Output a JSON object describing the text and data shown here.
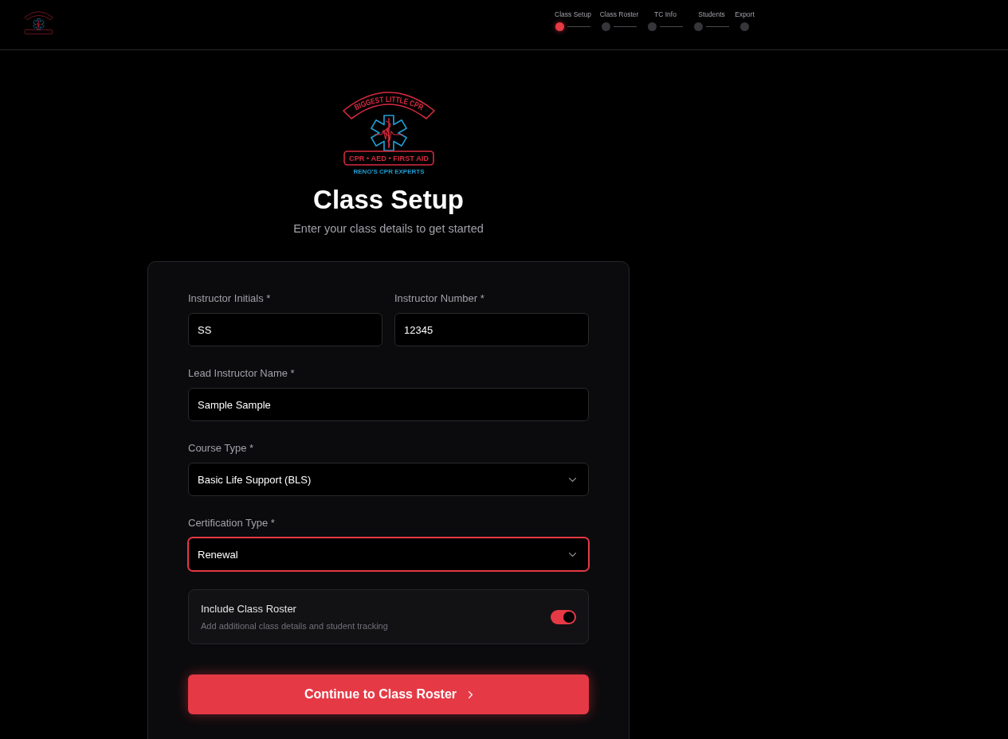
{
  "header": {
    "steps": [
      {
        "label": "Class Setup",
        "selected": true
      },
      {
        "label": "Class Roster",
        "selected": false
      },
      {
        "label": "TC Info",
        "selected": false
      },
      {
        "label": "Students",
        "selected": false
      },
      {
        "label": "Export",
        "selected": false
      }
    ]
  },
  "logo": {
    "banner": "BIGGEST LITTLE CPR",
    "tagline": "CPR • AED • FIRST AID",
    "caption": "RENO'S CPR EXPERTS"
  },
  "title": "Class Setup",
  "subtitle": "Enter your class details to get started",
  "form": {
    "rows": [
      [
        {
          "kind": "text",
          "label": "Instructor Initials *",
          "value": "SS",
          "focused": false
        },
        {
          "kind": "text",
          "label": "Instructor Number *",
          "value": "12345",
          "focused": false
        }
      ],
      [
        {
          "kind": "text",
          "label": "Lead Instructor Name *",
          "value": "Sample Sample",
          "focused": false
        }
      ],
      [
        {
          "kind": "select",
          "label": "Course Type *",
          "value": "Basic Life Support (BLS)",
          "focused": false
        }
      ],
      [
        {
          "kind": "select",
          "label": "Certification Type *",
          "value": "Renewal",
          "focused": true
        }
      ]
    ],
    "option": {
      "title": "Include Class Roster",
      "description": "Add additional class details and student tracking",
      "on": true
    },
    "submit": {
      "label": "Continue to Class Roster"
    }
  }
}
